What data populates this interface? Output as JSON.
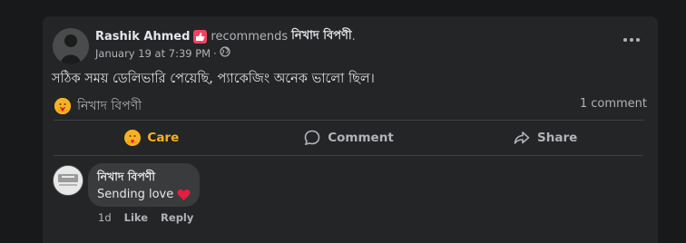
{
  "post": {
    "author": "Rashik Ahmed",
    "recommends_label": "recommends",
    "page_name": "নিখাদ বিপণী",
    "page_name_suffix": ".",
    "date": "January 19 at 7:39 PM",
    "dot_separator": "·",
    "privacy_icon": "globe-icon",
    "text": "সঠিক সময় ডেলিভারি পেয়েছি, প্যাকেজিং অনেক ভালো ছিল।",
    "reaction_page_name": "নিখাদ বিপণী",
    "reaction_emoji": "care-emoji",
    "comment_count": "1 comment"
  },
  "actions": {
    "care": "Care",
    "comment": "Comment",
    "share": "Share"
  },
  "comment": {
    "author": "নিখাদ বিপণী",
    "text": "Sending love",
    "time": "1d",
    "like": "Like",
    "reply": "Reply"
  },
  "colors": {
    "background": "#18191a",
    "card": "#242526",
    "bubble": "#3a3b3c",
    "care_accent": "#f7b125",
    "recommend_badge": "#f3425f",
    "heart": "#e41e3f",
    "secondary_text": "#b0b3b8"
  }
}
